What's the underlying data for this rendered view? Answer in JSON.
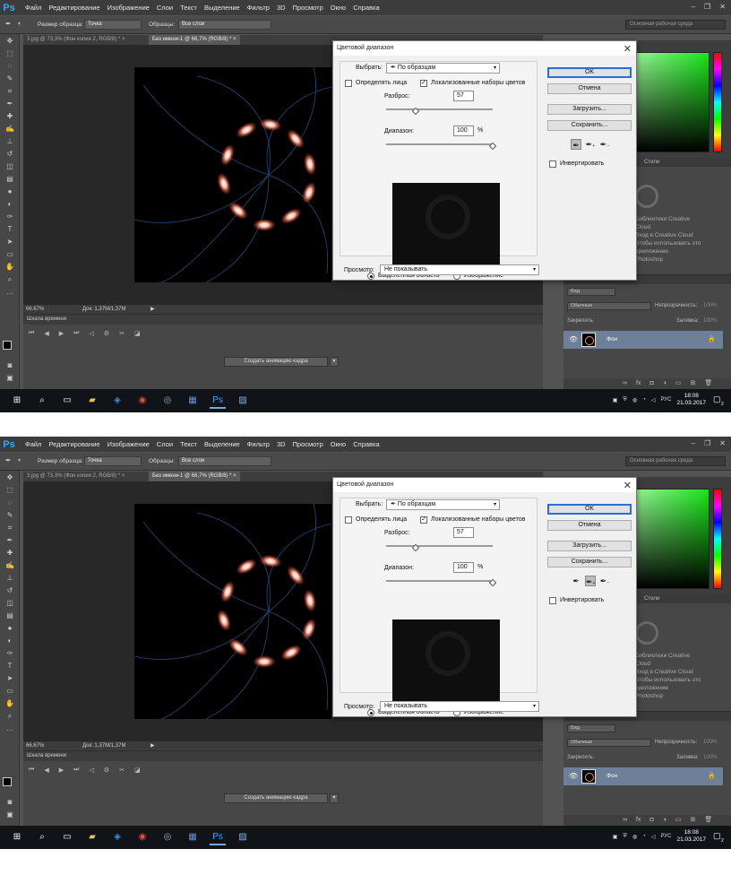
{
  "app": {
    "logo": "Ps",
    "menu": [
      "Файл",
      "Редактирование",
      "Изображение",
      "Слои",
      "Текст",
      "Выделение",
      "Фильтр",
      "3D",
      "Просмотр",
      "Окно",
      "Справка"
    ],
    "window_controls": [
      "–",
      "❐",
      "✕"
    ]
  },
  "options_bar": {
    "sample_size_label": "Размер образца:",
    "sample_size_value": "Точка",
    "samples_label": "Образцы:",
    "samples_value": "Все слои",
    "workspace": "Основная рабочая среда"
  },
  "tabs": [
    {
      "label": "3.jpg @ 73,3% (Фон копия 2, RGB/8) *",
      "close": "×"
    },
    {
      "label": "Без имени-1 @ 66,7% (RGB/8) *",
      "close": "×"
    }
  ],
  "status": {
    "zoom": "66.67%",
    "doc": "Док: 1,37M/1,37M"
  },
  "timeline": {
    "title": "Шкала времени",
    "create_button": "Создать анимацию кадра",
    "arrow": "▾"
  },
  "library": {
    "tab": "Стили",
    "text_lines": [
      "Библиотеки Creative",
      "Cloud",
      "Вход в Creative Cloud",
      "Чтобы использовать это приложение",
      "Photoshop"
    ]
  },
  "layers": {
    "kind_filter": "Вид",
    "blend_mode": "Обычные",
    "opacity_label": "Непрозрачность:",
    "opacity_value": "100%",
    "lock_label": "Закрепить:",
    "fill_label": "Заливка:",
    "fill_value": "100%",
    "layer_name": "Фон"
  },
  "taskbar": {
    "language": "РУС",
    "time": "18:08",
    "date": "21.03.2017",
    "notifications": "2"
  },
  "dialog": {
    "title": "Цветовой диапазон",
    "close": "✕",
    "select_label": "Выбрать:",
    "select_value": "По образцам",
    "detect_faces_label": "Определять лица",
    "localized_label": "Локализованные наборы цветов",
    "fuzziness_label": "Разброс:",
    "fuzziness_value": "57",
    "fuzziness_fraction": 0.28,
    "range_label": "Диапазон:",
    "range_value": "100",
    "range_unit": "%",
    "range_fraction": 1.0,
    "selection_label": "Выделенная область",
    "image_label": "Изображение",
    "preview_label": "Просмотр:",
    "preview_value": "Не показывать",
    "ok": "OK",
    "cancel": "Отмена",
    "load": "Загрузить...",
    "save": "Сохранить...",
    "invert_label": "Инвертировать"
  },
  "shots": [
    {
      "selected_eyedropper": 0
    },
    {
      "selected_eyedropper": 1
    }
  ],
  "colors": {
    "accent": "#31a8ff",
    "layer_selected": "#6d7f99",
    "primary_button_border": "#2b6fd6"
  }
}
